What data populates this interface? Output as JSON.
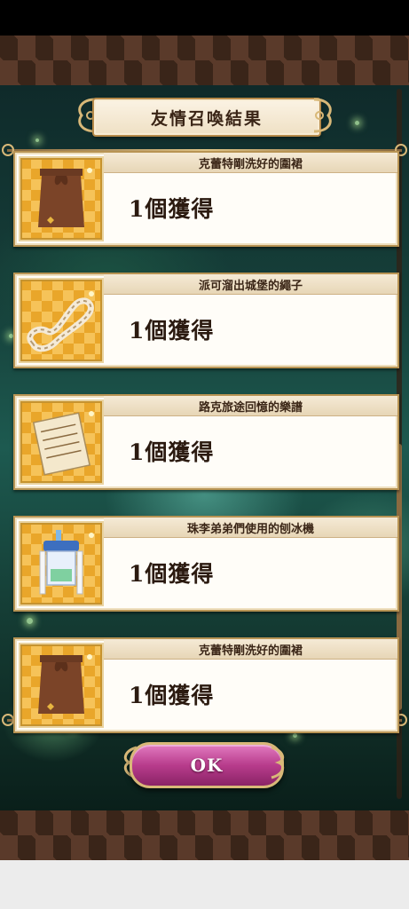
{
  "header": {
    "title": "友情召喚結果"
  },
  "results": [
    {
      "name": "克蕾特剛洗好的圍裙",
      "quantity": "1個獲得",
      "icon": "apron-icon"
    },
    {
      "name": "派可溜出城堡的繩子",
      "quantity": "1個獲得",
      "icon": "rope-icon"
    },
    {
      "name": "路克旅途回憶的樂譜",
      "quantity": "1個獲得",
      "icon": "sheet-music-icon"
    },
    {
      "name": "珠李弟弟們使用的刨冰機",
      "quantity": "1個獲得",
      "icon": "shaved-ice-machine-icon"
    },
    {
      "name": "克蕾特剛洗好的圍裙",
      "quantity": "1個獲得",
      "icon": "apron-icon"
    }
  ],
  "footer": {
    "ok_label": "OK"
  },
  "colors": {
    "accent_gold": "#b89454",
    "button_pink": "#b83c8c",
    "tile_orange": "#e9a62a"
  }
}
